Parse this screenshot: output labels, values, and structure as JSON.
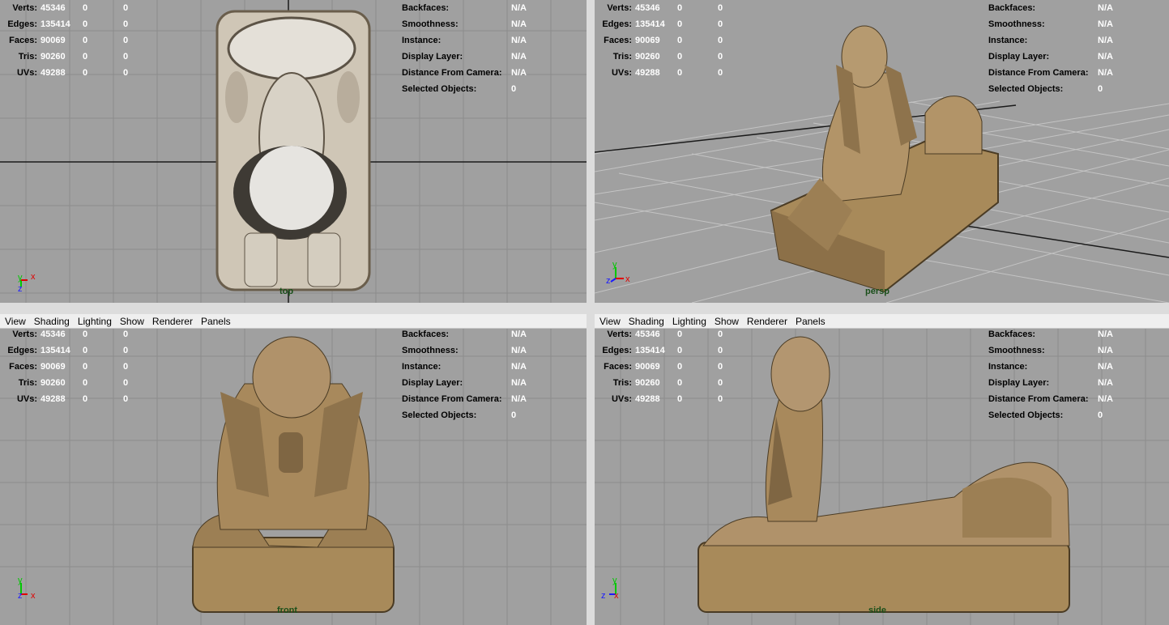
{
  "menu": [
    "View",
    "Shading",
    "Lighting",
    "Show",
    "Renderer",
    "Panels"
  ],
  "stats": {
    "rows": [
      {
        "label": "Verts:",
        "v1": "45346",
        "v2": "0",
        "v3": "0"
      },
      {
        "label": "Edges:",
        "v1": "135414",
        "v2": "0",
        "v3": "0"
      },
      {
        "label": "Faces:",
        "v1": "90069",
        "v2": "0",
        "v3": "0"
      },
      {
        "label": "Tris:",
        "v1": "90260",
        "v2": "0",
        "v3": "0"
      },
      {
        "label": "UVs:",
        "v1": "49288",
        "v2": "0",
        "v3": "0"
      }
    ],
    "right": [
      {
        "label": "Backfaces:",
        "value": "N/A"
      },
      {
        "label": "Smoothness:",
        "value": "N/A"
      },
      {
        "label": "Instance:",
        "value": "N/A"
      },
      {
        "label": "Display Layer:",
        "value": "N/A"
      },
      {
        "label": "Distance From Camera:",
        "value": "N/A"
      },
      {
        "label": "Selected Objects:",
        "value": "0"
      }
    ]
  },
  "viewports": {
    "top": {
      "camera": "top"
    },
    "persp": {
      "camera": "persp"
    },
    "front": {
      "camera": "front"
    },
    "side": {
      "camera": "side"
    }
  },
  "axis": {
    "x": "x",
    "y": "y",
    "z": "z"
  },
  "colors": {
    "viewport_bg": "#a0a0a0",
    "grid": "#8a8a8a",
    "axis_line": "#1a1a1a",
    "camera_label": "#1a4f1a",
    "stone": "#a88a5a"
  }
}
